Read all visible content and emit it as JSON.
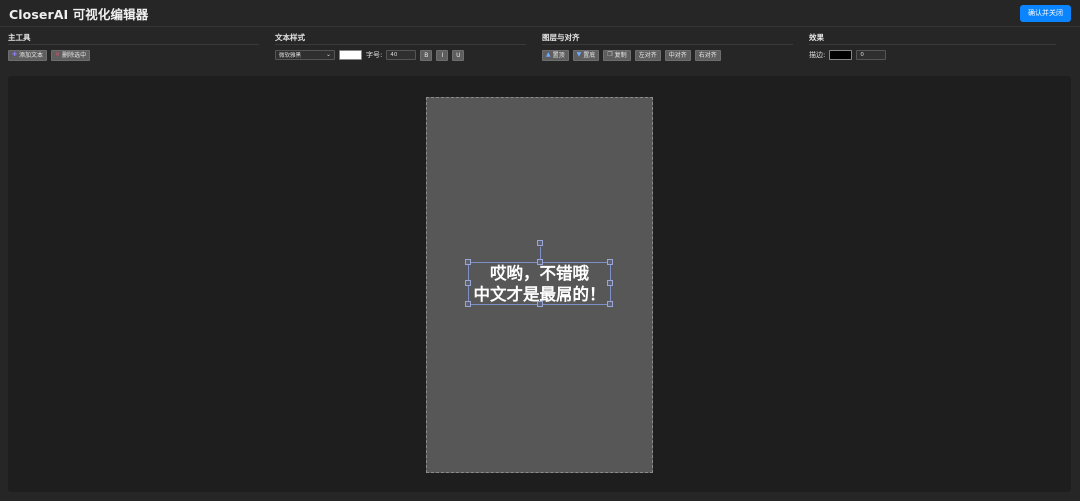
{
  "header": {
    "title": "CloserAI 可视化编辑器",
    "confirm_label": "确认并关闭",
    "accent_color": "#0a84ff"
  },
  "toolbar": {
    "main_tools": {
      "title": "主工具",
      "add_text_label": "添加文本",
      "add_text_icon": "plus-icon",
      "delete_label": "删除选中",
      "delete_icon": "close-icon"
    },
    "text_style": {
      "title": "文本样式",
      "font_value": "微软雅黑",
      "text_color": "#ffffff",
      "size_label": "字号:",
      "size_value": "40",
      "bold_label": "B",
      "italic_label": "I",
      "underline_label": "U"
    },
    "layer_align": {
      "title": "图层与对齐",
      "top_label": "置顶",
      "top_icon": "arrow-up-icon",
      "bottom_label": "置底",
      "bottom_icon": "arrow-down-icon",
      "copy_label": "复制",
      "copy_icon": "copy-icon",
      "align_left_label": "左对齐",
      "align_center_label": "中对齐",
      "align_right_label": "右对齐"
    },
    "effects": {
      "title": "效果",
      "stroke_label": "描边:",
      "stroke_color": "#000000",
      "stroke_width": "0"
    }
  },
  "canvas": {
    "background": "#575757",
    "text_lines": [
      "哎哟，不错哦",
      "中文才是最屌的！"
    ]
  }
}
